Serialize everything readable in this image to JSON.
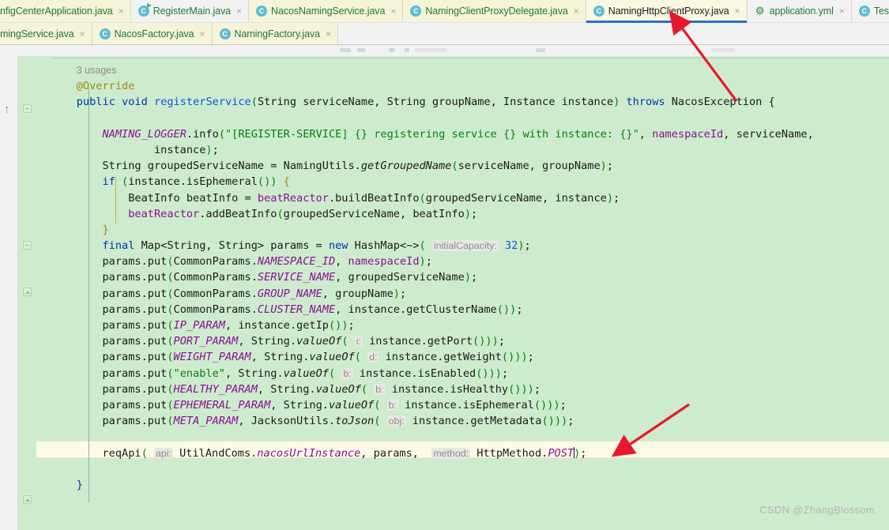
{
  "window": {
    "title": "NamingHttpClientProxy.java",
    "watermark": "CSDN @ZhangBlossom"
  },
  "tabs": {
    "row1": [
      {
        "label": "nfigCenterApplication.java",
        "icon": "java-class-icon",
        "clipped": true,
        "state": "inactive",
        "highlight": false,
        "close": "×"
      },
      {
        "label": "RegisterMain.java",
        "icon": "java-runnable-class-icon",
        "clipped": false,
        "state": "inactive",
        "highlight": false,
        "close": "×"
      },
      {
        "label": "NacosNamingService.java",
        "icon": "java-class-icon",
        "clipped": false,
        "state": "inactive",
        "highlight": true,
        "close": "×"
      },
      {
        "label": "NamingClientProxyDelegate.java",
        "icon": "java-class-icon",
        "clipped": false,
        "state": "inactive",
        "highlight": true,
        "close": "×"
      },
      {
        "label": "NamingHttpClientProxy.java",
        "icon": "java-class-icon",
        "clipped": false,
        "state": "active",
        "highlight": true,
        "close": "×"
      },
      {
        "label": "application.yml",
        "icon": "yaml-file-icon",
        "clipped": false,
        "state": "inactive",
        "highlight": false,
        "close": "×"
      },
      {
        "label": "TestC",
        "icon": "java-class-icon",
        "clipped": false,
        "state": "inactive",
        "highlight": false,
        "close": ""
      }
    ],
    "row2": [
      {
        "label": "mingService.java",
        "icon": "",
        "clipped": true,
        "state": "inactive",
        "highlight": true,
        "close": "×"
      },
      {
        "label": "NacosFactory.java",
        "icon": "java-class-icon",
        "clipped": false,
        "state": "inactive",
        "highlight": true,
        "close": "×"
      },
      {
        "label": "NamingFactory.java",
        "icon": "java-class-icon",
        "clipped": false,
        "state": "inactive",
        "highlight": true,
        "close": "×"
      }
    ],
    "icon_glyphs": {
      "java": "C",
      "yaml": "⚙"
    }
  },
  "editor": {
    "usages_text": "3 usages",
    "code_lines": [
      {
        "id": "l_usages",
        "text": "3 usages"
      },
      {
        "id": "l_override",
        "text": "@Override"
      },
      {
        "id": "l_sig",
        "text": "public void registerService(String serviceName, String groupName, Instance instance) throws NacosException {"
      },
      {
        "id": "l_blank1",
        "text": ""
      },
      {
        "id": "l_log1",
        "text": "NAMING_LOGGER.info(\"[REGISTER-SERVICE] {} registering service {} with instance: {}\", namespaceId, serviceName,"
      },
      {
        "id": "l_log2",
        "text": "instance);"
      },
      {
        "id": "l_grouped",
        "text": "String groupedServiceName = NamingUtils.getGroupedName(serviceName, groupName);"
      },
      {
        "id": "l_if",
        "text": "if (instance.isEphemeral()) {"
      },
      {
        "id": "l_beat1",
        "text": "BeatInfo beatInfo = beatReactor.buildBeatInfo(groupedServiceName, instance);"
      },
      {
        "id": "l_beat2",
        "text": "beatReactor.addBeatInfo(groupedServiceName, beatInfo);"
      },
      {
        "id": "l_closeif",
        "text": "}"
      },
      {
        "id": "l_map",
        "text": "final Map<String, String> params = new HashMap<~>( initialCapacity: 32);"
      },
      {
        "id": "l_p1",
        "text": "params.put(CommonParams.NAMESPACE_ID, namespaceId);"
      },
      {
        "id": "l_p2",
        "text": "params.put(CommonParams.SERVICE_NAME, groupedServiceName);"
      },
      {
        "id": "l_p3",
        "text": "params.put(CommonParams.GROUP_NAME, groupName);"
      },
      {
        "id": "l_p4",
        "text": "params.put(CommonParams.CLUSTER_NAME, instance.getClusterName());"
      },
      {
        "id": "l_p5",
        "text": "params.put(IP_PARAM, instance.getIp());"
      },
      {
        "id": "l_p6",
        "text": "params.put(PORT_PARAM, String.valueOf( i: instance.getPort()));"
      },
      {
        "id": "l_p7",
        "text": "params.put(WEIGHT_PARAM, String.valueOf( d: instance.getWeight()));"
      },
      {
        "id": "l_p8",
        "text": "params.put(\"enable\", String.valueOf( b: instance.isEnabled()));"
      },
      {
        "id": "l_p9",
        "text": "params.put(HEALTHY_PARAM, String.valueOf( b: instance.isHealthy()));"
      },
      {
        "id": "l_p10",
        "text": "params.put(EPHEMERAL_PARAM, String.valueOf( b: instance.isEphemeral()));"
      },
      {
        "id": "l_p11",
        "text": "params.put(META_PARAM, JacksonUtils.toJson( obj: instance.getMetadata()));"
      },
      {
        "id": "l_blank2",
        "text": ""
      },
      {
        "id": "l_req",
        "text": "reqApi( api: UtilAndComs.nacosUrlInstance, params,  method: HttpMethod.POST);"
      },
      {
        "id": "l_blank3",
        "text": ""
      },
      {
        "id": "l_end",
        "text": "}"
      }
    ],
    "tokens": {
      "kw_public": "public",
      "kw_void": "void",
      "kw_if": "if",
      "kw_final": "final",
      "kw_new": "new",
      "kw_throws": "throws",
      "annotation_override": "@Override",
      "method_name": "registerService",
      "exception": "NacosException",
      "logger": "NAMING_LOGGER",
      "log_string": "\"[REGISTER-SERVICE] {} registering service {} with instance: {}\"",
      "hint_initial_capacity": "initialCapacity:",
      "hint_i": "i:",
      "hint_d": "d:",
      "hint_b": "b:",
      "hint_obj": "obj:",
      "hint_api": "api:",
      "hint_method": "method:",
      "num_32": "32",
      "str_enable": "\"enable\"",
      "const_post": "POST"
    },
    "colors": {
      "background": "#cdeccd",
      "caret_line": "#fdfbe8",
      "keyword": "#0033b3",
      "string": "#067d17",
      "field": "#871094",
      "method": "#1750eb",
      "annotation": "#9e880d",
      "comment": "#8c8c8c",
      "tab_active_underline": "#2a6fc9",
      "annotation_arrow": "#e8192c"
    }
  },
  "annotations": {
    "arrow_top": "red-arrow-pointing-to-active-tab",
    "arrow_bottom": "red-arrow-pointing-to-reqApi-line"
  }
}
